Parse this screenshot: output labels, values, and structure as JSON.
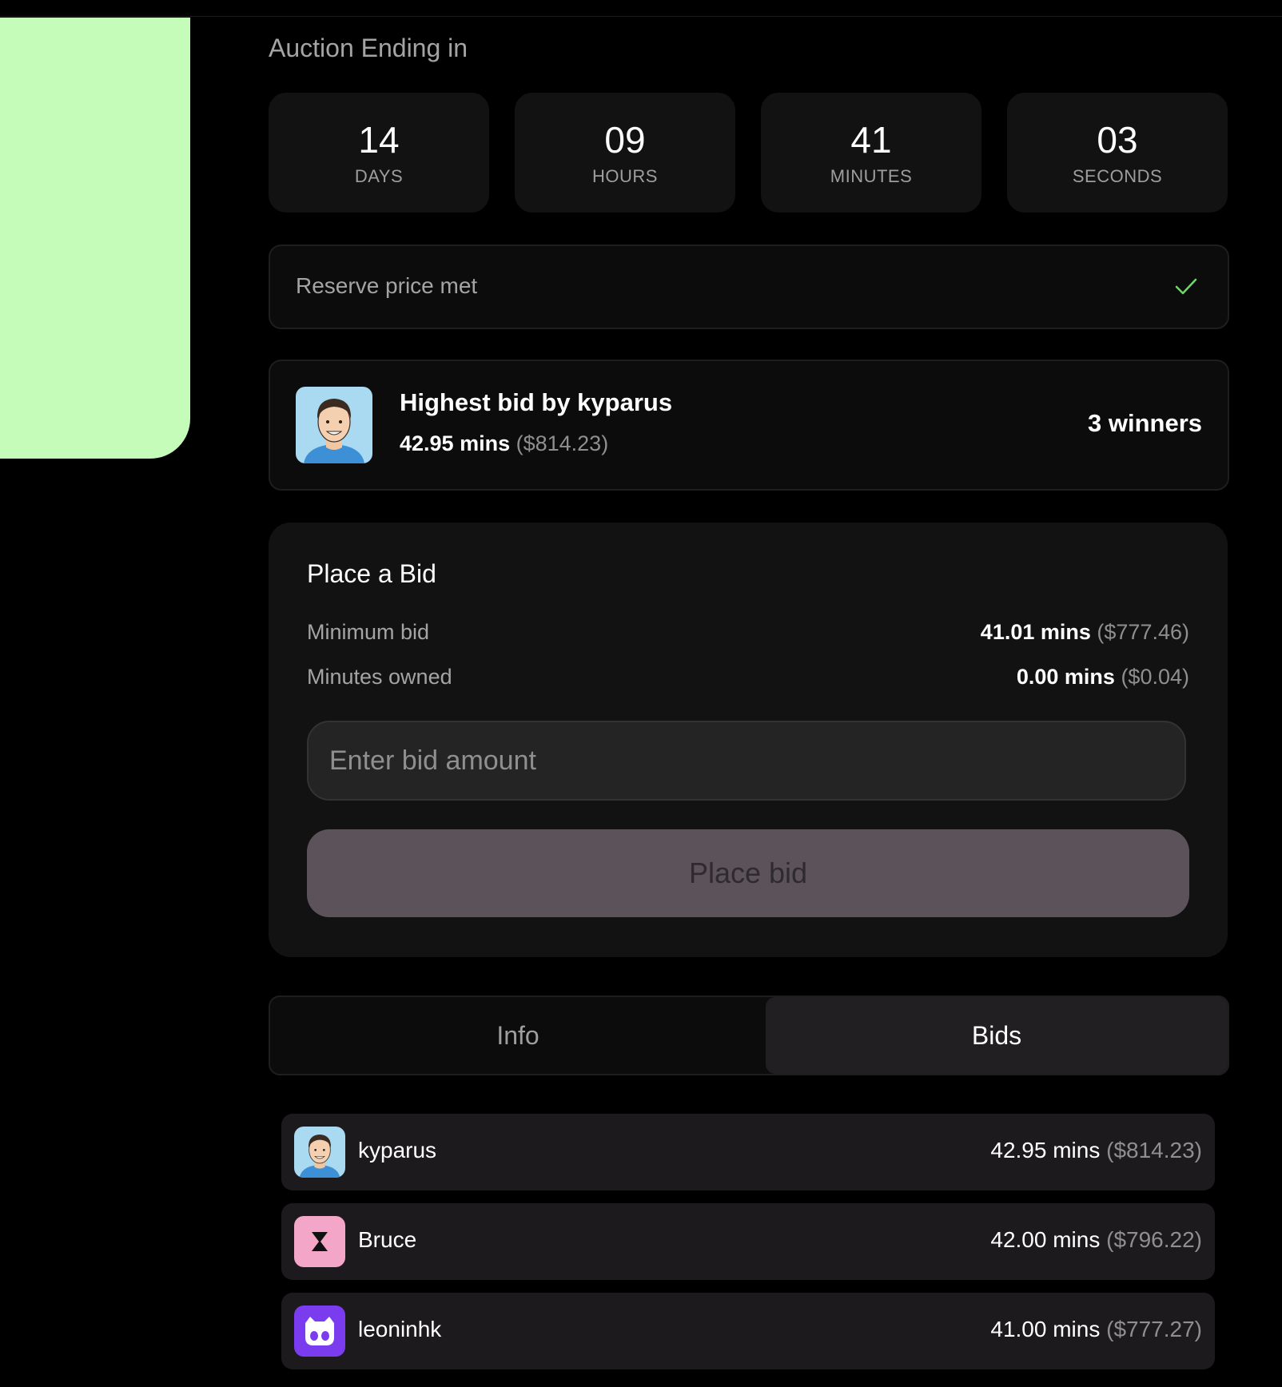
{
  "auction": {
    "title": "Auction Ending in",
    "countdown": [
      {
        "value": "14",
        "label": "DAYS"
      },
      {
        "value": "09",
        "label": "HOURS"
      },
      {
        "value": "41",
        "label": "MINUTES"
      },
      {
        "value": "03",
        "label": "SECONDS"
      }
    ]
  },
  "reserve": {
    "text": "Reserve price met",
    "icon": "check-icon",
    "icon_color": "#6fd86b"
  },
  "highest": {
    "title": "Highest bid by kyparus",
    "amount": "42.95 mins",
    "usd": "($814.23)",
    "winners": "3 winners"
  },
  "bid_form": {
    "title": "Place a Bid",
    "minimum_label": "Minimum bid",
    "minimum_value": "41.01 mins",
    "minimum_usd": "($777.46)",
    "owned_label": "Minutes owned",
    "owned_value": "0.00 mins",
    "owned_usd": "($0.04)",
    "input_placeholder": "Enter bid amount",
    "input_value": "",
    "button_label": "Place bid"
  },
  "tabs": [
    {
      "label": "Info",
      "active": false
    },
    {
      "label": "Bids",
      "active": true
    }
  ],
  "bids": [
    {
      "name": "kyparus",
      "amount": "42.95 mins",
      "usd": "($814.23)",
      "avatar": "man-portrait-avatar"
    },
    {
      "name": "Bruce",
      "amount": "42.00 mins",
      "usd": "($796.22)",
      "avatar": "hourglass-avatar"
    },
    {
      "name": "leoninhk",
      "amount": "41.00 mins",
      "usd": "($777.27)",
      "avatar": "cat-face-avatar"
    }
  ],
  "colors": {
    "accent_green": "#c5fcb9",
    "button_bg": "#5c535a",
    "bruce_avatar_bg": "#f4a6c8",
    "leoninhk_avatar_bg": "#7b3cf0"
  }
}
